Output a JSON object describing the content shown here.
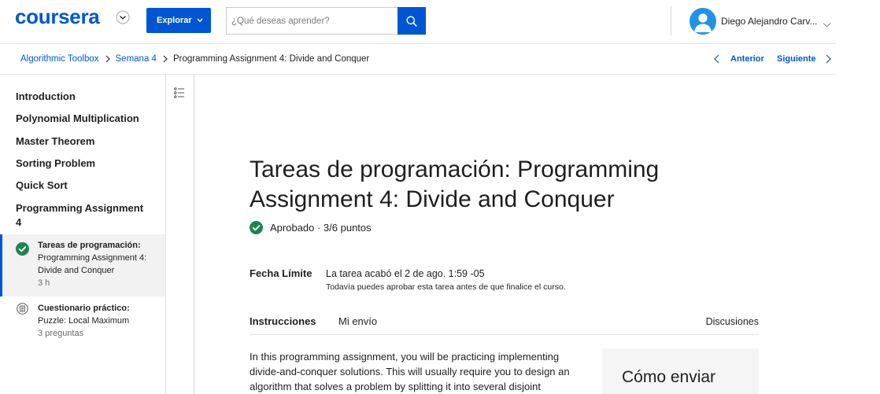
{
  "header": {
    "logo_text": "coursera",
    "menu_toggle_icon": "chevron-down-icon",
    "explore_label": "Explorar",
    "search_placeholder": "¿Qué deseas aprender?",
    "search_icon": "search-icon",
    "avatar_icon": "person-icon",
    "user_name": "Diego Alejandro Carv..."
  },
  "breadcrumb": {
    "items": [
      "Algorithmic Toolbox",
      "Semana 4",
      "Programming Assignment 4: Divide and Conquer"
    ],
    "prev_label": "Anterior",
    "next_label": "Siguiente"
  },
  "sidebar": {
    "modules": [
      "Introduction",
      "Polynomial Multiplication",
      "Master Theorem",
      "Sorting Problem",
      "Quick Sort",
      "Programming Assignment 4"
    ],
    "lessons": [
      {
        "type_label": "Tareas de programación:",
        "title": "Programming Assignment 4: Divide and Conquer",
        "meta": "3 h",
        "icon": "check-circle-icon",
        "selected": true
      },
      {
        "type_label": "Cuestionario práctico:",
        "title": "Puzzle: Local Maximum",
        "meta": "3 preguntas",
        "icon": "quiz-icon",
        "selected": false
      }
    ],
    "outline_icon": "list-icon"
  },
  "assignment": {
    "title": "Tareas de programación: Programming Assignment 4: Divide and Conquer",
    "status_icon": "check-circle-icon",
    "status": "Aprobado · 3/6 puntos",
    "due_label": "Fecha Límite",
    "due_value": "La tarea acabó el 2 de ago. 1:59 -05",
    "due_note": "Todavía puedes aprobar esta tarea antes de que finalice el curso.",
    "tabs": [
      {
        "label": "Instrucciones",
        "active": true
      },
      {
        "label": "Mi envío",
        "active": false
      }
    ],
    "discussions_label": "Discusiones",
    "instructions_text": "In this programming assignment, you will be practicing implementing divide-and-conquer solutions. This will usually require you to design an algorithm that solves a problem by splitting it into several disjoint",
    "how_to_submit_title": "Cómo enviar"
  },
  "colors": {
    "brand": "#0056D2",
    "success": "#1F8354",
    "selected_bg": "#F2F2F2",
    "avatar": "#2391E6"
  }
}
